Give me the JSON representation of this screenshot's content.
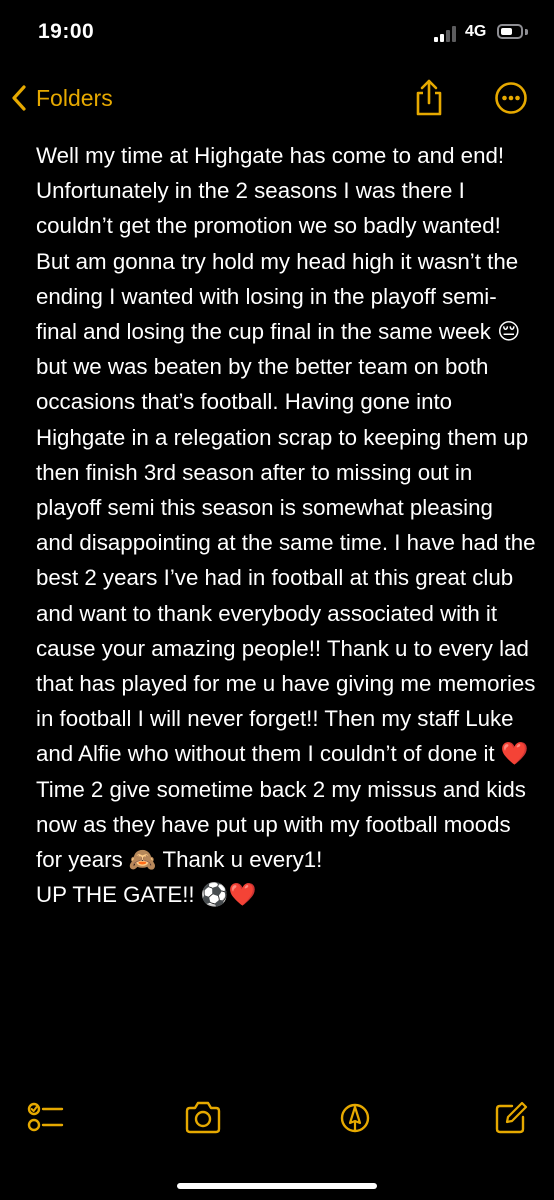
{
  "status_bar": {
    "time": "19:00",
    "network": "4G",
    "battery_level": 0.6
  },
  "nav": {
    "back_label": "Folders"
  },
  "note": {
    "text": "Well my time at Highgate has come to and end! Unfortunately in the 2 seasons I was there I couldn’t get the promotion we so badly wanted! But am gonna try hold my head high it wasn’t the ending I wanted with losing in the playoff semi-final and losing the cup final in the same week 😔 but we was beaten by the better team on both occasions that’s football. Having gone into Highgate in a relegation scrap to keeping them up then finish 3rd season after to missing out in playoff semi this season is somewhat pleasing and disappointing at the same time. I have had the best 2 years I’ve had in football at this great club and want to thank everybody associated with it cause your amazing people!! Thank u to every lad that has played for me u have giving me memories in football I will never forget!! Then my staff Luke and Alfie who without them I couldn’t of done it ❤️ Time 2 give sometime back 2 my missus and kids now as they have put up with my football moods for years 🙈 Thank u every1!\nUP THE GATE!! ⚽️❤️"
  },
  "colors": {
    "accent": "#e6a900",
    "background": "#000000",
    "text": "#ffffff"
  },
  "toolbar": {
    "icons": [
      "checklist-icon",
      "camera-icon",
      "markup-icon",
      "compose-icon"
    ]
  }
}
